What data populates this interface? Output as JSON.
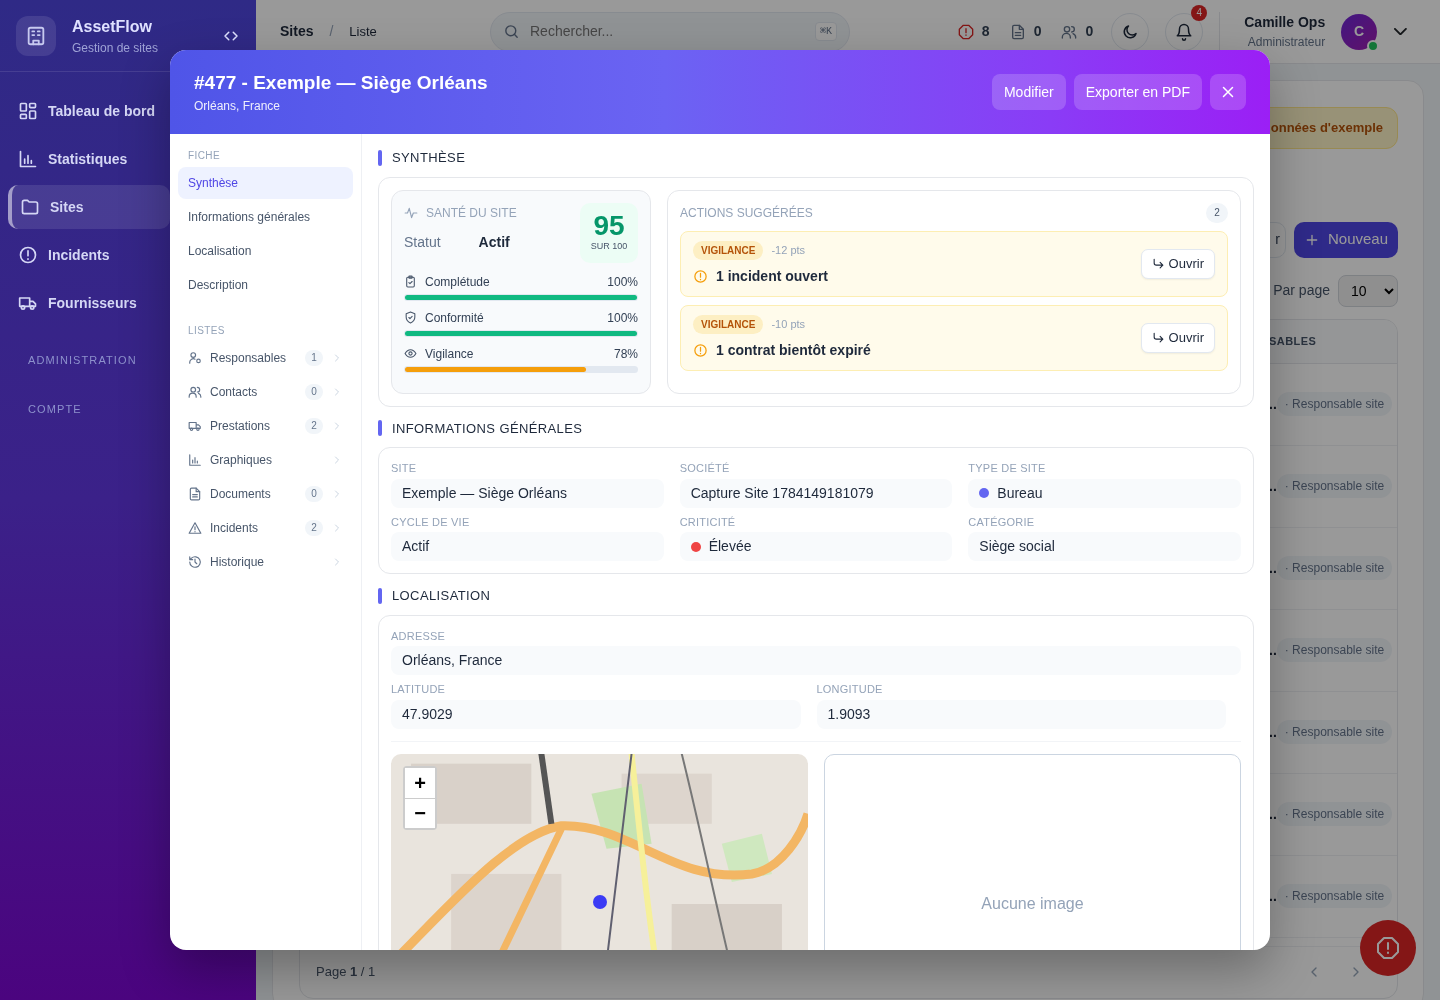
{
  "sidebar": {
    "brand": {
      "name": "AssetFlow",
      "tagline": "Gestion de sites"
    },
    "items": [
      {
        "label": "Tableau de bord",
        "selected": false
      },
      {
        "label": "Statistiques",
        "selected": false
      },
      {
        "label": "Sites",
        "selected": true
      },
      {
        "label": "Incidents",
        "selected": false
      },
      {
        "label": "Fournisseurs",
        "selected": false
      }
    ],
    "sections": [
      "ADMINISTRATION",
      "COMPTE"
    ]
  },
  "topbar": {
    "breadcrumb": [
      "Sites",
      "Liste"
    ],
    "breadcrumb_separator": "/",
    "search": {
      "placeholder": "Rechercher...",
      "shortcut": "⌘K"
    },
    "stats": [
      "8",
      "0",
      "0"
    ],
    "notifications": "4",
    "user": {
      "name": "Camille Ops",
      "role": "Administrateur",
      "initial": "C",
      "online": true
    }
  },
  "background": {
    "banner": "onnées d'exemple",
    "partial_button": "r",
    "new_button": "Nouveau",
    "per_page": {
      "label": "Par page",
      "value": "10"
    },
    "table": {
      "column": "SABLES",
      "rows": [
        {
          "name": "..",
          "role": "· Responsable site"
        },
        {
          "name": "..",
          "role": "· Responsable site"
        },
        {
          "name": "..",
          "role": "· Responsable site"
        },
        {
          "name": "..",
          "role": "· Responsable site"
        },
        {
          "name": "..",
          "role": "· Responsable site"
        },
        {
          "name": "..",
          "role": "· Responsable site"
        },
        {
          "name": "..",
          "role": "· Responsable site"
        }
      ]
    },
    "footer": "Page **1** / 1"
  },
  "modal": {
    "title": "#477 - Exemple — Siège Orléans",
    "subtitle": "Orléans, France",
    "buttons": [
      "Modifier",
      "Exporter en PDF"
    ],
    "nav": [
      {
        "title": "FICHE",
        "items": [
          {
            "label": "Synthèse",
            "selected": true
          },
          {
            "label": "Informations générales",
            "selected": false
          },
          {
            "label": "Localisation",
            "selected": false
          },
          {
            "label": "Description",
            "selected": false
          }
        ]
      },
      {
        "title": "LISTES",
        "items": [
          {
            "label": "Responsables",
            "count": "1",
            "selected": false
          },
          {
            "label": "Contacts",
            "count": "0",
            "selected": false
          },
          {
            "label": "Prestations",
            "count": "2",
            "selected": false
          },
          {
            "label": "Graphiques",
            "selected": false
          },
          {
            "label": "Documents",
            "count": "0",
            "selected": false
          },
          {
            "label": "Incidents",
            "count": "2",
            "selected": false
          },
          {
            "label": "Historique",
            "selected": false
          }
        ]
      }
    ],
    "synthese": {
      "title": "SYNTHÈSE",
      "health": {
        "title": "SANTÉ DU SITE",
        "status_label": "Statut",
        "status": "Actif",
        "score": "95",
        "score_caption": "SUR 100",
        "metrics": [
          {
            "label": "Complétude",
            "value": "100%",
            "level": 1,
            "color": "#10b981"
          },
          {
            "label": "Conformité",
            "value": "100%",
            "level": 1,
            "color": "#10b981"
          },
          {
            "label": "Vigilance",
            "value": "78%",
            "level": 0.78,
            "color": "#f59e0b"
          }
        ]
      },
      "actions": {
        "title": "ACTIONS SUGGÉRÉES",
        "count": "2",
        "items": [
          {
            "tag": "VIGILANCE",
            "points": "-12 pts",
            "text": "1 incident ouvert",
            "button": "Ouvrir"
          },
          {
            "tag": "VIGILANCE",
            "points": "-10 pts",
            "text": "1 contrat bientôt expiré",
            "button": "Ouvrir"
          }
        ]
      }
    },
    "general": {
      "title": "INFORMATIONS GÉNÉRALES",
      "fields": [
        {
          "label": "SITE",
          "value": "Exemple — Siège Orléans"
        },
        {
          "label": "SOCIÉTÉ",
          "value": "Capture Site 1784149181079"
        },
        {
          "label": "TYPE DE SITE",
          "value": "Bureau",
          "color": "#6366f1"
        },
        {
          "label": "CYCLE DE VIE",
          "value": "Actif"
        },
        {
          "label": "CRITICITÉ",
          "value": "Élevée",
          "color": "#ef4444"
        },
        {
          "label": "CATÉGORIE",
          "value": "Siège social"
        }
      ]
    },
    "location": {
      "title": "LOCALISATION",
      "address": {
        "label": "ADRESSE",
        "value": "Orléans, France"
      },
      "latitude": {
        "label": "LATITUDE",
        "value": "47.9029"
      },
      "longitude": {
        "label": "LONGITUDE",
        "value": "1.9093"
      },
      "map": {
        "kind": "picture",
        "zoom_in": "+",
        "zoom_out": "−"
      },
      "image_placeholder": "Aucune image"
    }
  }
}
